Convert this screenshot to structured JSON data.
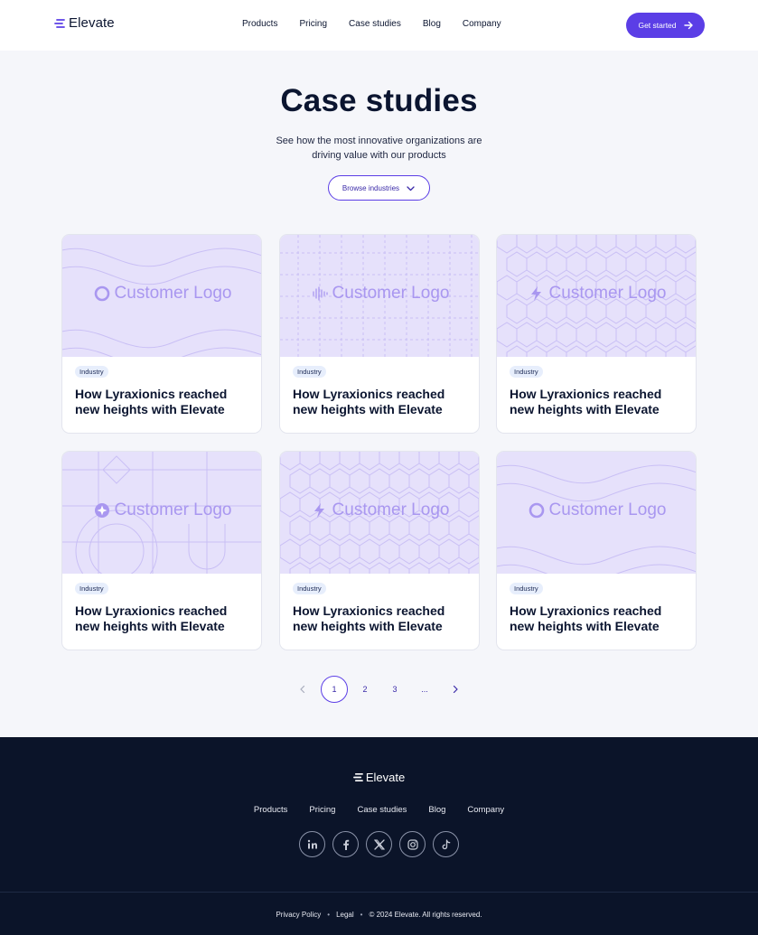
{
  "brand": {
    "name": "Elevate",
    "accent": "#5b3ee6",
    "footer_bg": "#0b1429"
  },
  "nav": {
    "items": [
      "Products",
      "Pricing",
      "Case studies",
      "Blog",
      "Company"
    ],
    "cta_label": "Get started"
  },
  "hero": {
    "title": "Case studies",
    "subtitle_line1": "See how the most innovative organizations are",
    "subtitle_line2": "driving value with our products",
    "browse_label": "Browse industries"
  },
  "cards": [
    {
      "logo_text": "Customer Logo",
      "logo_icon": "ring-icon",
      "badge": "Industry",
      "title": "How Lyraxionics reached new heights with Elevate",
      "pattern": "waves"
    },
    {
      "logo_text": "Customer Logo",
      "logo_icon": "soundwave-icon",
      "badge": "Industry",
      "title": "How Lyraxionics reached new heights with Elevate",
      "pattern": "grid"
    },
    {
      "logo_text": "Customer Logo",
      "logo_icon": "bolt-icon",
      "badge": "Industry",
      "title": "How Lyraxionics reached new heights with Elevate",
      "pattern": "hex"
    },
    {
      "logo_text": "Customer Logo",
      "logo_icon": "star-badge-icon",
      "badge": "Industry",
      "title": "How Lyraxionics reached new heights with Elevate",
      "pattern": "geo"
    },
    {
      "logo_text": "Customer Logo",
      "logo_icon": "bolt-icon",
      "badge": "Industry",
      "title": "How Lyraxionics reached new heights with Elevate",
      "pattern": "hex"
    },
    {
      "logo_text": "Customer Logo",
      "logo_icon": "ring-icon",
      "badge": "Industry",
      "title": "How Lyraxionics reached new heights with Elevate",
      "pattern": "waves"
    }
  ],
  "pagination": {
    "pages": [
      "1",
      "2",
      "3",
      "..."
    ],
    "current": "1"
  },
  "footer": {
    "nav": [
      "Products",
      "Pricing",
      "Case studies",
      "Blog",
      "Company"
    ],
    "socials": [
      "linkedin-icon",
      "facebook-icon",
      "x-icon",
      "instagram-icon",
      "tiktok-icon"
    ],
    "legal": {
      "privacy": "Privacy Policy",
      "legal": "Legal",
      "copyright": "© 2024 Elevate. All rights reserved."
    }
  }
}
